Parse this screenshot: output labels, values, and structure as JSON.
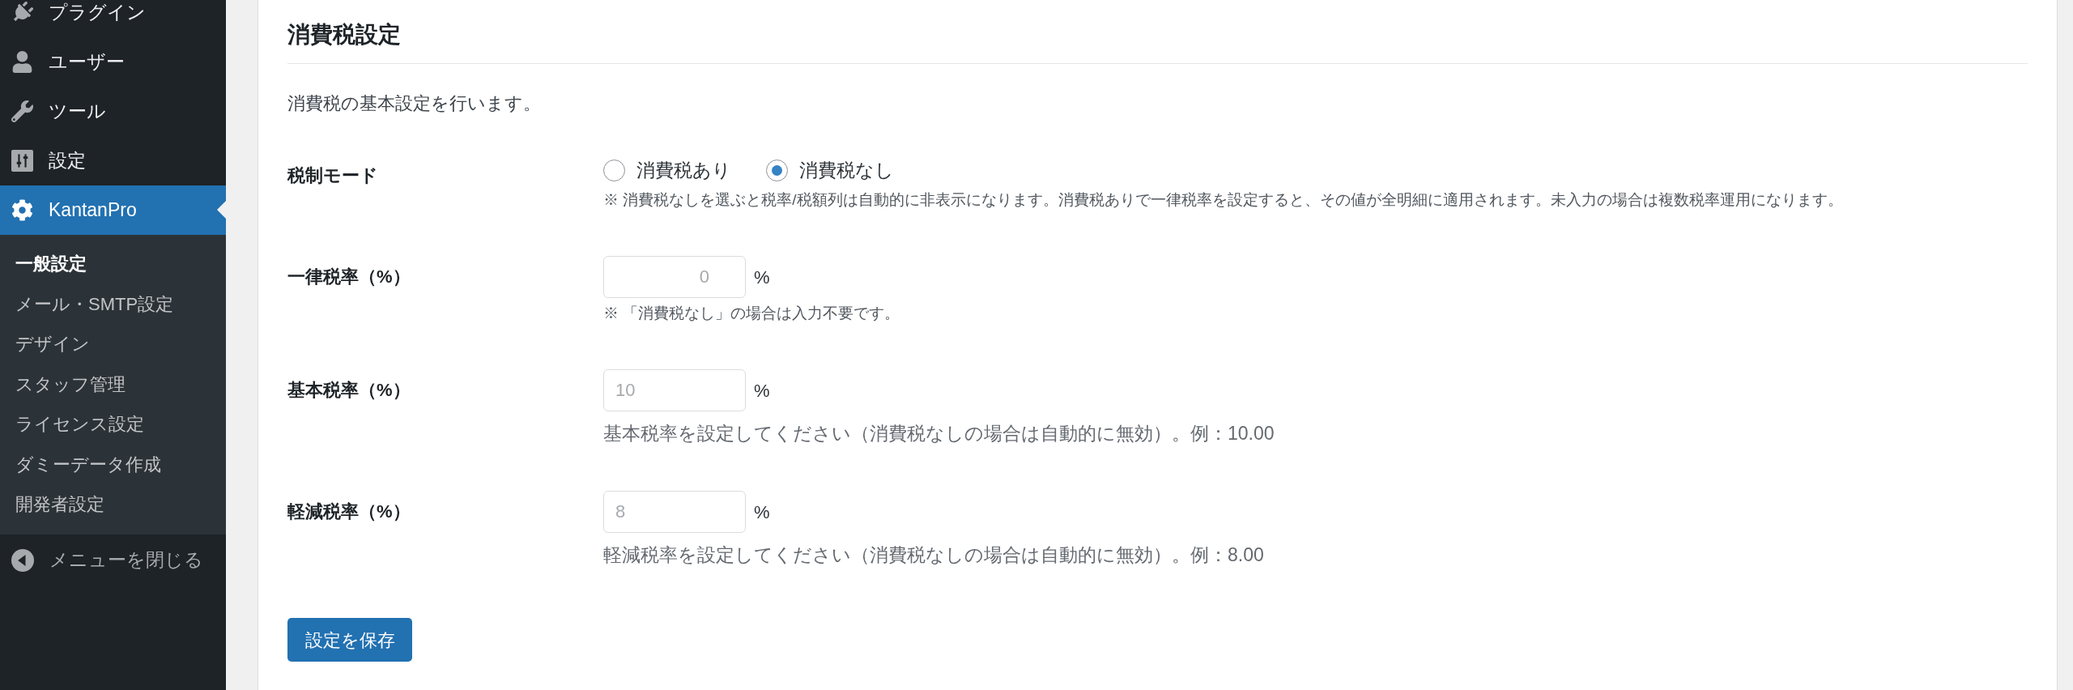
{
  "sidebar": {
    "menu": [
      {
        "label": "プラグイン",
        "selected": false
      },
      {
        "label": "ユーザー",
        "selected": false
      },
      {
        "label": "ツール",
        "selected": false
      },
      {
        "label": "設定",
        "selected": false
      },
      {
        "label": "KantanPro",
        "selected": true,
        "children": [
          {
            "label": "一般設定",
            "selected": true
          },
          {
            "label": "メール・SMTP設定",
            "selected": false
          },
          {
            "label": "デザイン",
            "selected": false
          },
          {
            "label": "スタッフ管理",
            "selected": false
          },
          {
            "label": "ライセンス設定",
            "selected": false
          },
          {
            "label": "ダミーデータ作成",
            "selected": false
          },
          {
            "label": "開発者設定",
            "selected": false
          }
        ]
      }
    ],
    "collapse": {
      "label": "メニューを閉じる"
    }
  },
  "section": {
    "title": "消費税設定",
    "description": "消費税の基本設定を行います。",
    "fields": [
      {
        "kind": "radio",
        "label": "税制モード",
        "options": [
          {
            "label": "消費税あり",
            "selected": false
          },
          {
            "label": "消費税なし",
            "selected": true
          }
        ],
        "note": "※ 消費税なしを選ぶと税率/税額列は自動的に非表示になります。消費税ありで一律税率を設定すると、その値が全明細に適用されます。未入力の場合は複数税率運用になります。"
      },
      {
        "kind": "number",
        "label": "一律税率（%）",
        "placeholder": "0",
        "unit": "%",
        "note": "※ 「消費税なし」の場合は入力不要です。"
      },
      {
        "kind": "text",
        "label": "基本税率（%）",
        "placeholder": "10",
        "unit": "%",
        "description": "基本税率を設定してください（消費税なしの場合は自動的に無効）。例：10.00"
      },
      {
        "kind": "text",
        "label": "軽減税率（%）",
        "placeholder": "8",
        "unit": "%",
        "description": "軽減税率を設定してください（消費税なしの場合は自動的に無効）。例：8.00"
      }
    ],
    "save_button": "設定を保存"
  }
}
